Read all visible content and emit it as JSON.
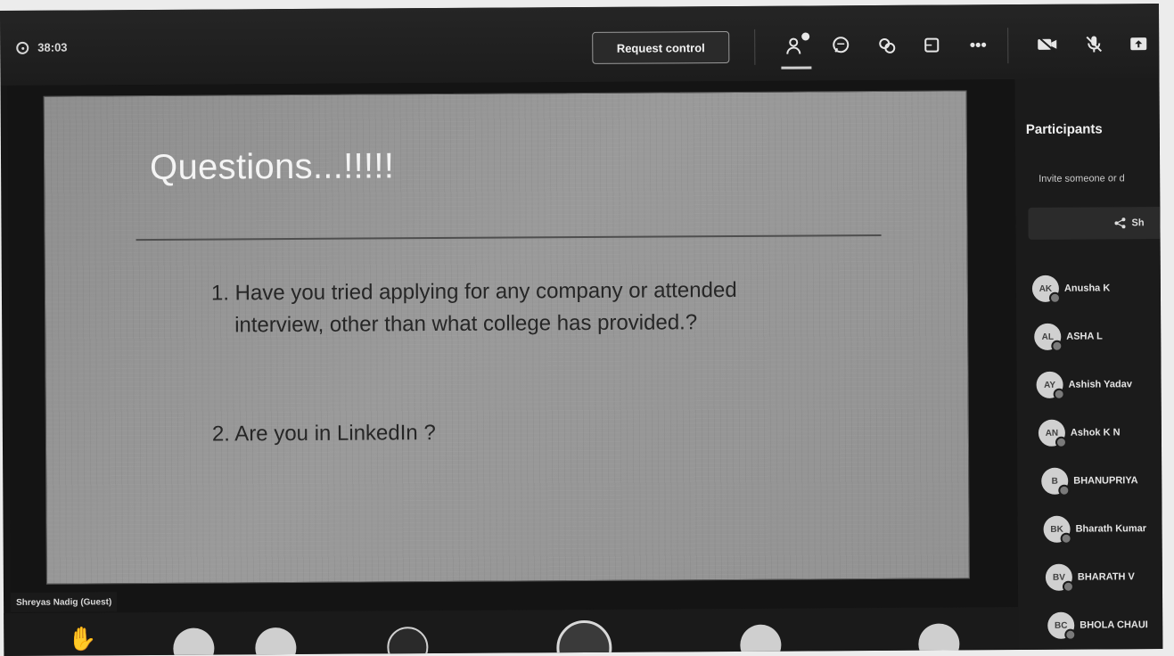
{
  "topbar": {
    "timer": "38:03",
    "request_control_label": "Request control",
    "icons": {
      "people": "people-icon",
      "chat": "chat-icon",
      "reactions": "reactions-icon",
      "rooms": "rooms-icon",
      "more": "more-icon",
      "camera": "camera-off-icon",
      "mic": "mic-off-icon",
      "share": "share-tray-icon"
    }
  },
  "slide": {
    "title": "Questions...!!!!!",
    "q1_line1": "1. Have you tried applying for any company or attended",
    "q1_line2": "interview, other than what college has provided.?",
    "q2": "2.  Are you in LinkedIn ?"
  },
  "presenter_name": "Shreyas Nadig (Guest)",
  "participants": {
    "title": "Participants",
    "invite_text": "Invite someone or d",
    "share_label": "Sh",
    "people": [
      {
        "initials": "AK",
        "name": "Anusha K"
      },
      {
        "initials": "AL",
        "name": "ASHA L"
      },
      {
        "initials": "AY",
        "name": "Ashish Yadav"
      },
      {
        "initials": "AN",
        "name": "Ashok K N"
      },
      {
        "initials": "B",
        "name": "BHANUPRIYA"
      },
      {
        "initials": "BK",
        "name": "Bharath Kumar"
      },
      {
        "initials": "BV",
        "name": "BHARATH V"
      },
      {
        "initials": "BC",
        "name": "BHOLA CHAUI"
      }
    ]
  },
  "colors": {
    "background": "#161616",
    "slide": "#959595",
    "avatar": "#d0d0d0"
  }
}
